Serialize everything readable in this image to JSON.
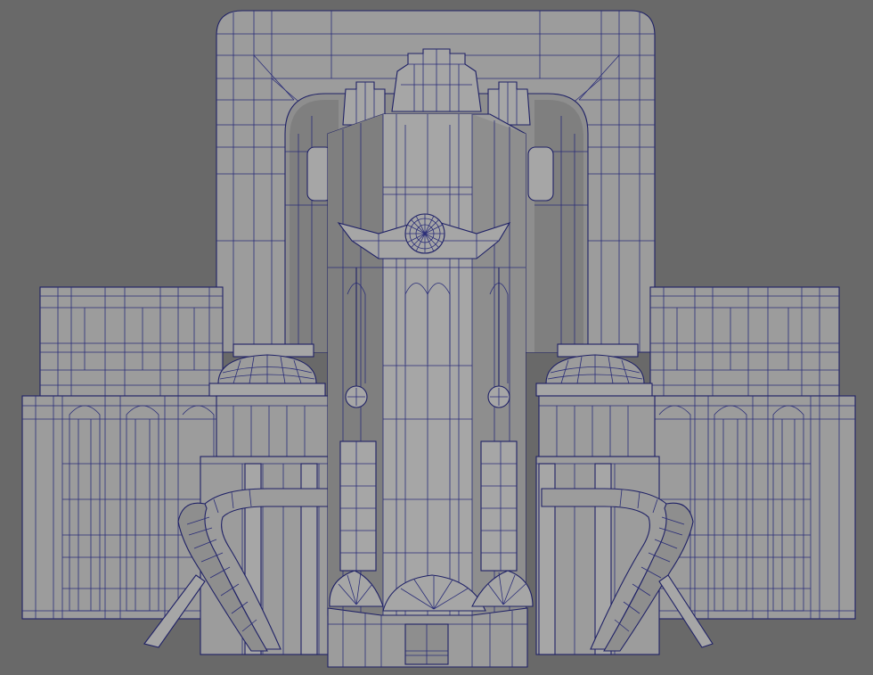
{
  "viewport": {
    "background": "#696969",
    "wire_color": "#2a2d78",
    "surface_color": "#9c9c9c",
    "display_mode": "wireframe-on-shaded"
  },
  "model": {
    "subject": "art-deco-building",
    "parts": [
      "rear-tower",
      "arch-frame",
      "central-clock-tower",
      "clock-face",
      "left-wing",
      "right-wing",
      "left-dome",
      "right-dome",
      "left-curved-ramp",
      "right-curved-ramp",
      "fan-ornaments",
      "entrance-door",
      "crown-ornament"
    ]
  }
}
